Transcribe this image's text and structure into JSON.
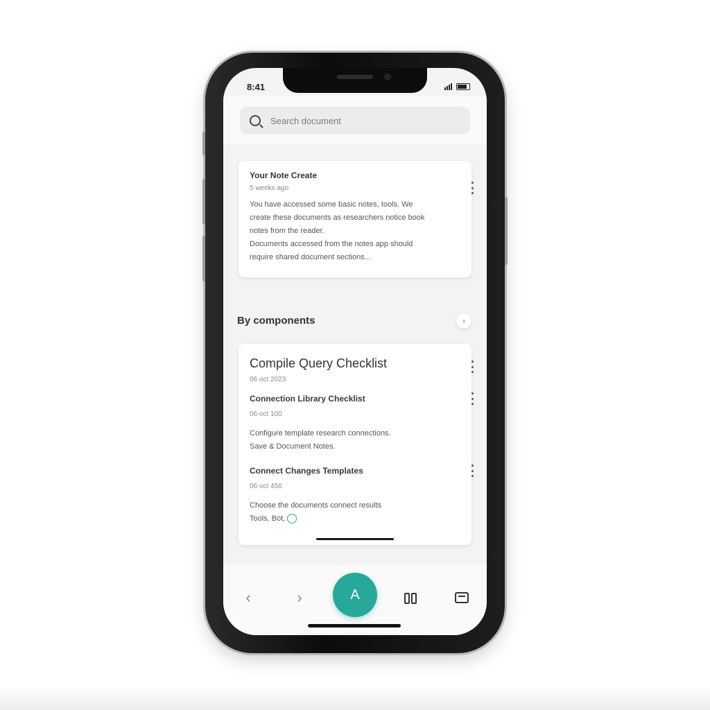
{
  "status_bar": {
    "time": "8:41"
  },
  "search": {
    "placeholder": "Search document"
  },
  "card1": {
    "title": "Your Note Create",
    "meta": "5 weeks ago",
    "body_lines": [
      "You have accessed some basic notes, tools. We",
      "create these documents as researchers notice book",
      "notes from the reader.",
      "Documents accessed from the notes app should",
      "require shared document sections..."
    ]
  },
  "section": {
    "title": "By components"
  },
  "card2": {
    "title": "Compile Query Checklist",
    "meta": "06 oct 2023",
    "item1": {
      "title": "Connection Library Checklist",
      "meta": "06 oct 100",
      "body_lines": [
        "Configure template research connections.",
        "Save & Document Notes."
      ]
    },
    "item2": {
      "title": "Connect Changes Templates",
      "meta": "06 oct 456",
      "body_lines": [
        "Choose the documents connect results",
        "Tools, Bot,"
      ]
    }
  },
  "bottom_nav": {
    "back": "‹",
    "forward": "›",
    "fab_label": "A"
  },
  "colors": {
    "accent": "#27a999",
    "background": "#f2f3f3"
  },
  "icons": [
    "search-icon",
    "kebab-menu-icon",
    "chevron-left-icon",
    "chevron-right-icon",
    "book-icon",
    "tabs-icon",
    "plus-circle-icon"
  ]
}
